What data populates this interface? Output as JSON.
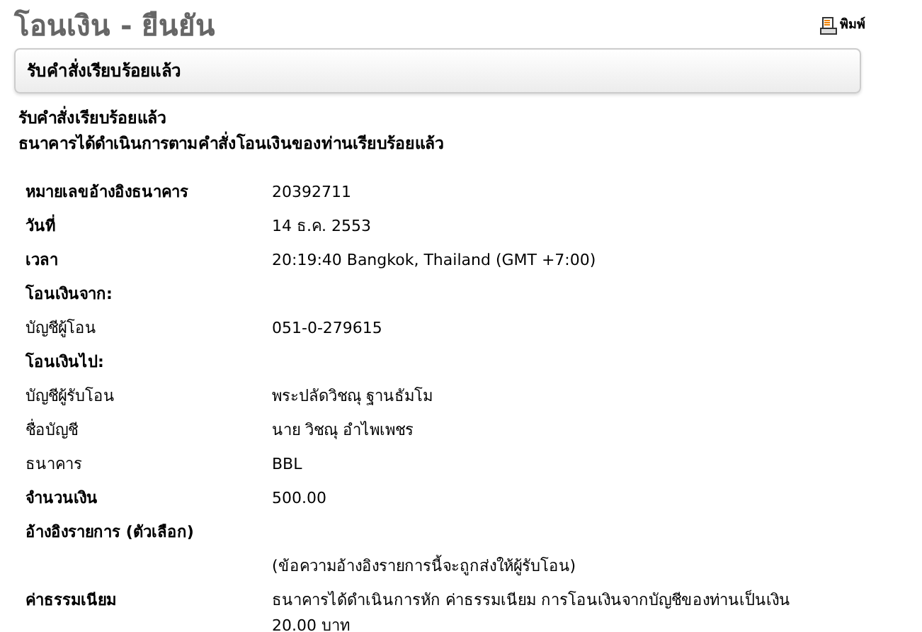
{
  "title": "โอนเงิน - ยืนยัน",
  "print_link": "พิมพ์",
  "panel_header": "รับคำสั่งเรียบร้อยแล้ว",
  "messages": [
    "รับคำสั่งเรียบร้อยแล้ว",
    "ธนาคารได้ดำเนินการตามคำสั่งโอนเงินของท่านเรียบร้อยแล้ว"
  ],
  "details": [
    {
      "label": "หมายเลขอ้างอิงธนาคาร",
      "bold": true,
      "value": "20392711"
    },
    {
      "label": "วันที่",
      "bold": true,
      "value": "14 ธ.ค. 2553"
    },
    {
      "label": "เวลา",
      "bold": true,
      "value": "20:19:40 Bangkok, Thailand (GMT +7:00)"
    },
    {
      "label": "โอนเงินจาก:",
      "bold": true
    },
    {
      "label": "บัญชีผู้โอน",
      "bold": false,
      "value": "051-0-279615"
    },
    {
      "label": "โอนเงินไป:",
      "bold": true
    },
    {
      "label": "บัญชีผู้รับโอน",
      "bold": false,
      "value": "พระปลัดวิชณุ ฐานธัมโม"
    },
    {
      "label": "ชื่อบัญชี",
      "bold": false,
      "value": "นาย วิชณุ อำไพเพชร"
    },
    {
      "label": "ธนาคาร",
      "bold": false,
      "value": "BBL"
    },
    {
      "label": "จำนวนเงิน",
      "bold": true,
      "value": "500.00"
    },
    {
      "label": "อ้างอิงรายการ (ตัวเลือก)",
      "bold": true
    },
    {
      "value": "(ข้อความอ้างอิงรายการนี้จะถูกส่งให้ผู้รับโอน)"
    },
    {
      "label": "ค่าธรรมเนียม",
      "bold": true,
      "value": "ธนาคารได้ดำเนินการหัก ค่าธรรมเนียม การโอนเงินจากบัญชีของท่านเป็นเงิน 20.00 บาท"
    }
  ]
}
